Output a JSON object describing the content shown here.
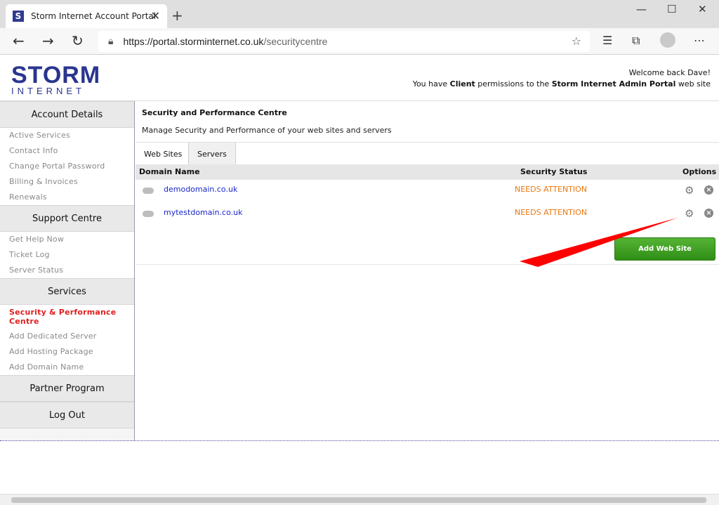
{
  "browser": {
    "tab_title": "Storm Internet Account Portal",
    "url_host": "https://portal.storminternet.co.uk",
    "url_path": "/securitycentre"
  },
  "header": {
    "logo_top": "STORM",
    "logo_bottom": "INTERNET",
    "welcome": "Welcome back Dave!",
    "perm_prefix": "You have ",
    "perm_role": "Client",
    "perm_mid": " permissions to the ",
    "perm_portal": "Storm Internet Admin Portal",
    "perm_suffix": " web site"
  },
  "sidebar": {
    "sections": [
      {
        "title": "Account Details",
        "links": [
          "Active Services",
          "Contact Info",
          "Change Portal Password",
          "Billing & Invoices",
          "Renewals"
        ]
      },
      {
        "title": "Support Centre",
        "links": [
          "Get Help Now",
          "Ticket Log",
          "Server Status"
        ]
      },
      {
        "title": "Services",
        "active_link": "Security & Performance Centre",
        "links": [
          "Add Dedicated Server",
          "Add Hosting Package",
          "Add Domain Name"
        ]
      },
      {
        "title": "Partner Program"
      },
      {
        "title": "Log Out"
      }
    ]
  },
  "main": {
    "title": "Security and Performance Centre",
    "description": "Manage Security and Performance of your web sites and servers",
    "tabs": [
      "Web Sites",
      "Servers"
    ],
    "columns": {
      "domain": "Domain Name",
      "status": "Security Status",
      "options": "Options"
    },
    "rows": [
      {
        "domain": "demodomain.co.uk",
        "status": "NEEDS ATTENTION"
      },
      {
        "domain": "mytestdomain.co.uk",
        "status": "NEEDS ATTENTION"
      }
    ],
    "add_button": "Add Web Site"
  },
  "colors": {
    "accent": "#2a3590",
    "status": "#e8780c",
    "active_link": "#e02020",
    "button": "#3a9a1e",
    "annotation_arrow": "#ff0000"
  }
}
